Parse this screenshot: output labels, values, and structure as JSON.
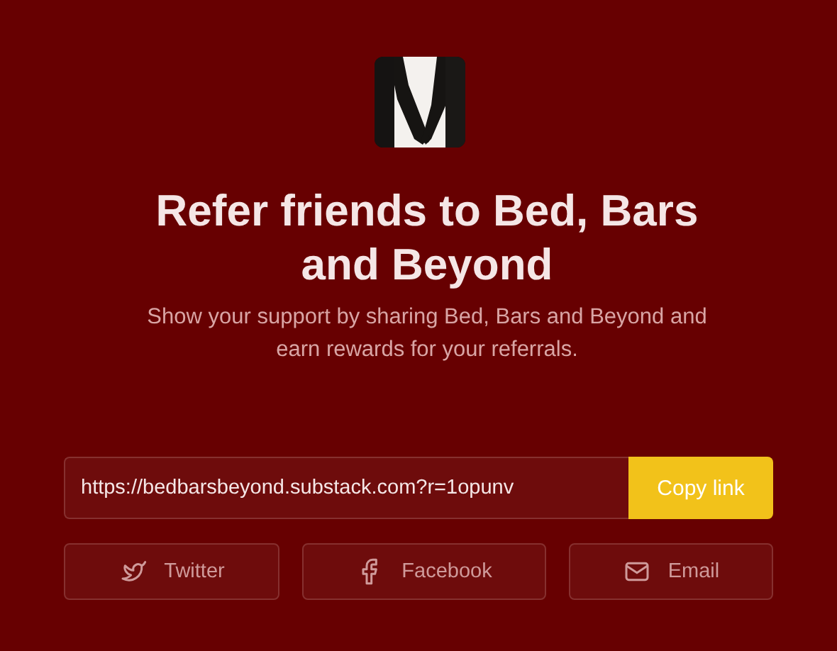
{
  "title": "Refer friends to Bed, Bars and Beyond",
  "subtitle": "Show your support by sharing Bed, Bars and Beyond and earn rewards for your referrals.",
  "link": {
    "value": "https://bedbarsbeyond.substack.com?r=1opunv",
    "button": "Copy link"
  },
  "share_buttons": [
    {
      "kind": "twitter",
      "label": "Twitter"
    },
    {
      "kind": "facebook",
      "label": "Facebook"
    },
    {
      "kind": "email",
      "label": "Email"
    }
  ]
}
